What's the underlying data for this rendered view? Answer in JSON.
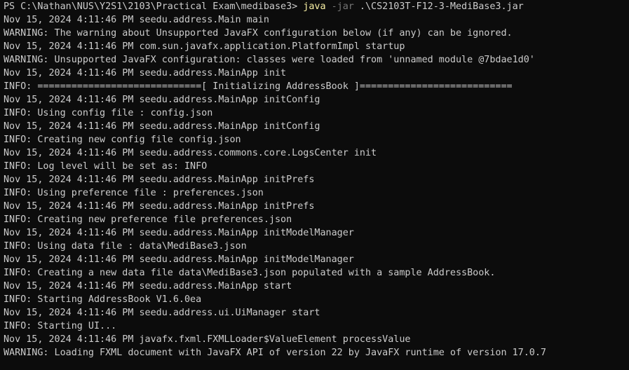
{
  "colors": {
    "background": "#0c0c0c",
    "text": "#cccccc",
    "command": "#f9f1a5",
    "parameter": "#767676"
  },
  "prompt": {
    "path": "PS C:\\Nathan\\NUS\\Y2S1\\2103\\Practical Exam\\medibase3> ",
    "command": "java",
    "parameter": " -jar",
    "argument": " .\\CS2103T-F12-3-MediBase3.jar"
  },
  "lines": [
    "Nov 15, 2024 4:11:46 PM seedu.address.Main main",
    "WARNING: The warning about Unsupported JavaFX configuration below (if any) can be ignored.",
    "Nov 15, 2024 4:11:46 PM com.sun.javafx.application.PlatformImpl startup",
    "WARNING: Unsupported JavaFX configuration: classes were loaded from 'unnamed module @7bdae1d0'",
    "Nov 15, 2024 4:11:46 PM seedu.address.MainApp init",
    "INFO: =============================[ Initializing AddressBook ]===========================",
    "Nov 15, 2024 4:11:46 PM seedu.address.MainApp initConfig",
    "INFO: Using config file : config.json",
    "Nov 15, 2024 4:11:46 PM seedu.address.MainApp initConfig",
    "INFO: Creating new config file config.json",
    "Nov 15, 2024 4:11:46 PM seedu.address.commons.core.LogsCenter init",
    "INFO: Log level will be set as: INFO",
    "Nov 15, 2024 4:11:46 PM seedu.address.MainApp initPrefs",
    "INFO: Using preference file : preferences.json",
    "Nov 15, 2024 4:11:46 PM seedu.address.MainApp initPrefs",
    "INFO: Creating new preference file preferences.json",
    "Nov 15, 2024 4:11:46 PM seedu.address.MainApp initModelManager",
    "INFO: Using data file : data\\MediBase3.json",
    "Nov 15, 2024 4:11:46 PM seedu.address.MainApp initModelManager",
    "INFO: Creating a new data file data\\MediBase3.json populated with a sample AddressBook.",
    "Nov 15, 2024 4:11:46 PM seedu.address.MainApp start",
    "INFO: Starting AddressBook V1.6.0ea",
    "Nov 15, 2024 4:11:46 PM seedu.address.ui.UiManager start",
    "INFO: Starting UI...",
    "Nov 15, 2024 4:11:46 PM javafx.fxml.FXMLLoader$ValueElement processValue",
    "WARNING: Loading FXML document with JavaFX API of version 22 by JavaFX runtime of version 17.0.7"
  ]
}
